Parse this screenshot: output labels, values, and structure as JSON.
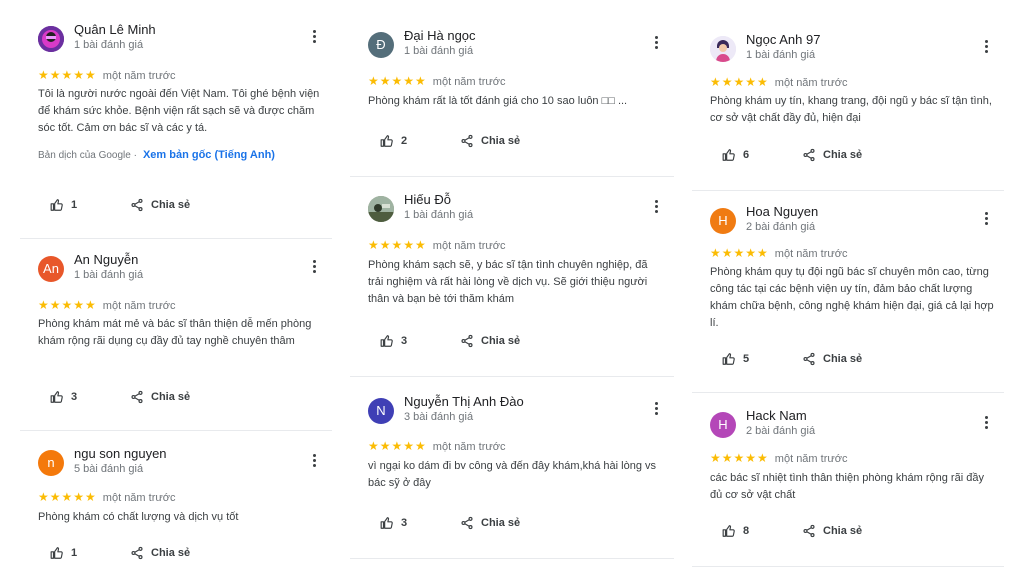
{
  "ui": {
    "share_label": "Chia sẻ",
    "star_glyphs": "★★★★★"
  },
  "colors": {
    "star": "#fbbc04",
    "link": "#1a73e8"
  },
  "reviews": [
    {
      "name": "Quân Lê Minh",
      "count": "1 bài đánh giá",
      "avatar": "purple-photo-avatar",
      "rating": 5,
      "time": "một năm trước",
      "text": "Tôi là người nước ngoài đến Việt Nam. Tôi ghé bệnh viện để khám sức khỏe. Bệnh viện rất sạch sẽ và được chăm sóc tốt. Cảm ơn bác sĩ và các y tá.",
      "translated_by": "Bản dịch của Google ·",
      "see_original": "Xem bản gốc (Tiếng Anh)",
      "likes": "1"
    },
    {
      "name": "An Nguyễn",
      "count": "1 bài đánh giá",
      "avatar_letter": "An",
      "avatar_color": "#e8572a",
      "rating": 5,
      "time": "một năm trước",
      "text": "Phòng khám mát mẻ và bác sĩ thân thiện dễ mến phòng khám rộng rãi dụng cụ đầy đủ tay nghề chuyên thâm",
      "likes": "3"
    },
    {
      "name": "ngu son nguyen",
      "count": "5 bài đánh giá",
      "avatar_letter": "n",
      "avatar_color": "#f4790b",
      "rating": 5,
      "time": "một năm trước",
      "text": "Phòng khám có chất lượng và dịch vụ tốt",
      "likes": "1"
    },
    {
      "name": "Đại Hà ngọc",
      "count": "1 bài đánh giá",
      "avatar_letter": "Đ",
      "avatar_color": "#546e7a",
      "rating": 5,
      "time": "một năm trước",
      "text": "Phòng khám rất là tốt đánh giá cho 10 sao luôn □□ ...",
      "likes": "2"
    },
    {
      "name": "Hiếu Đỗ",
      "count": "1 bài đánh giá",
      "avatar": "landscape-photo-avatar",
      "rating": 5,
      "time": "một năm trước",
      "text": "Phòng khám sạch sẽ, y bác sĩ tận tình chuyên nghiệp, đã trải nghiệm và rất hài lòng về dịch vụ. Sẽ giới thiệu người thân và bạn bè tới thăm khám",
      "likes": "3"
    },
    {
      "name": "Nguyễn Thị Anh Đào",
      "count": "3 bài đánh giá",
      "avatar_letter": "N",
      "avatar_color": "#3f3fb5",
      "rating": 5,
      "time": "một năm trước",
      "text": "vì ngại ko dám đi bv công và đến đây khám,khá hài lòng vs bác sỹ ở đây",
      "likes": "3"
    },
    {
      "name": "Ngọc Anh 97",
      "count": "1 bài đánh giá",
      "avatar": "person-illustration-avatar",
      "rating": 5,
      "time": "một năm trước",
      "text": "Phòng khám uy tín, khang trang, đội ngũ y bác sĩ tận tình, cơ sở vật chất đầy đủ, hiện đại",
      "likes": "6"
    },
    {
      "name": "Hoa Nguyen",
      "count": "2 bài đánh giá",
      "avatar_letter": "H",
      "avatar_color": "#f07b12",
      "rating": 5,
      "time": "một năm trước",
      "text": "Phòng khám quy tụ đội ngũ bác sĩ chuyên môn cao, từng công tác tại các bệnh viện uy tín, đảm bảo chất lượng khám chữa bệnh, công nghệ khám hiện đại, giá cả lại hợp lí.",
      "likes": "5"
    },
    {
      "name": "Hack Nam",
      "count": "2 bài đánh giá",
      "avatar_letter": "H",
      "avatar_color": "#b447b8",
      "rating": 5,
      "time": "một năm trước",
      "text": "các bác sĩ nhiệt tình thân thiện phòng khám rộng rãi đầy đủ cơ sở vật chất",
      "likes": "8"
    }
  ]
}
